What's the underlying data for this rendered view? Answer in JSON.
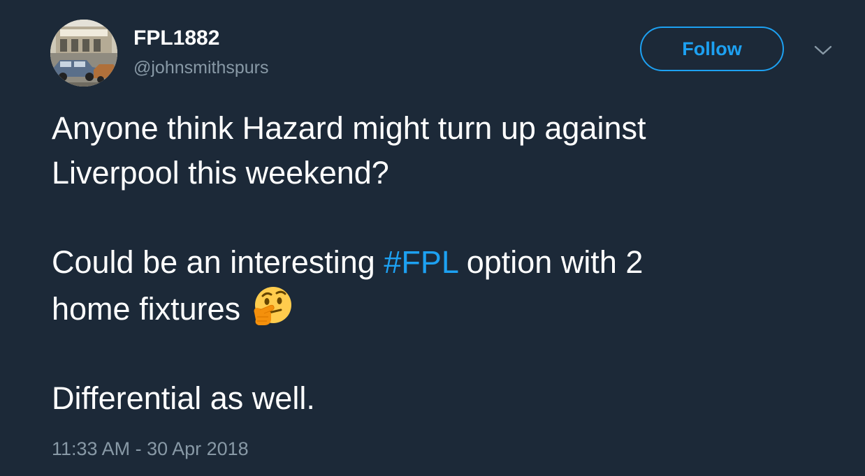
{
  "author": {
    "display_name": "FPL1882",
    "username": "@johnsmithspurs"
  },
  "follow_button": {
    "label": "Follow"
  },
  "tweet": {
    "line1": "Anyone think Hazard might turn up against",
    "line2": "Liverpool this weekend?",
    "line3_before": "Could be an interesting ",
    "hashtag": "#FPL",
    "line3_after": " option with 2",
    "line4": "home fixtures",
    "emoji": "thinking-face",
    "line5": "Differential as well."
  },
  "timestamp": "11:33 AM - 30 Apr 2018",
  "colors": {
    "background": "#1c2938",
    "accent": "#1da1f2",
    "secondary_text": "#8899a6",
    "primary_text": "#ffffff"
  }
}
